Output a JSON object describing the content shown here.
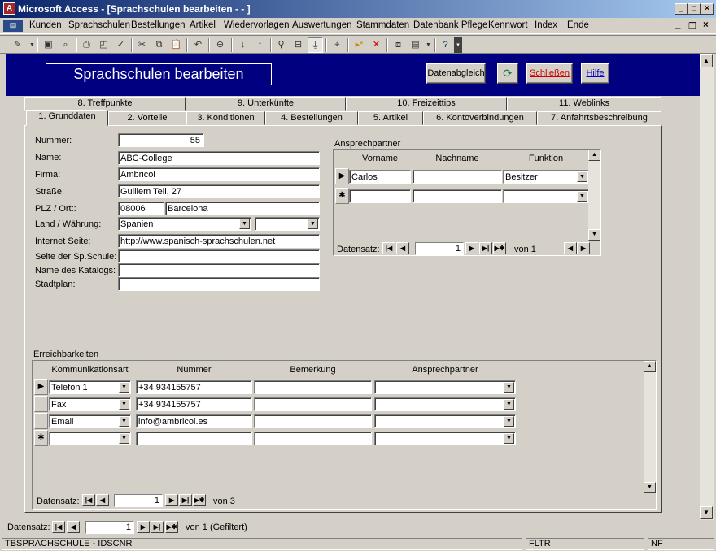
{
  "window": {
    "title": "Microsoft Access - [Sprachschulen bearbeiten - - ]"
  },
  "menu": [
    "Kunden",
    "Sprachschulen",
    "Bestellungen",
    "Artikel",
    "Wiedervorlagen",
    "Auswertungen",
    "Stammdaten",
    "Datenbank Pflege",
    "Kennwort",
    "Index",
    "Ende"
  ],
  "header": {
    "title": "Sprachschulen bearbeiten",
    "btn_sync": "Datenabgleich",
    "btn_close": "Schließen",
    "btn_help": "Hilfe"
  },
  "tabs_top": [
    "8. Treffpunkte",
    "9. Unterkünfte",
    "10. Freizeittips",
    "11. Weblinks"
  ],
  "tabs_bottom": [
    "1. Grunddaten",
    "2. Vorteile",
    "3. Konditionen",
    "4. Bestellungen",
    "5. Artikel",
    "6. Kontoverbindungen",
    "7. Anfahrtsbeschreibung"
  ],
  "form": {
    "labels": {
      "nummer": "Nummer:",
      "name": "Name:",
      "firma": "Firma:",
      "strasse": "Straße:",
      "plz": "PLZ / Ort::",
      "land": "Land / Währung:",
      "internet": "Internet Seite:",
      "seite": "Seite der Sp.Schule:",
      "katalog": "Name des Katalogs:",
      "stadtplan": "Stadtplan:"
    },
    "values": {
      "nummer": "55",
      "name": "ABC-College",
      "firma": "Ambricol",
      "strasse": "Guillem Tell, 27",
      "plz": "08006",
      "ort": "Barcelona",
      "land": "Spanien",
      "waehrung": "",
      "internet": "http://www.spanisch-sprachschulen.net",
      "seite": "",
      "katalog": "",
      "stadtplan": ""
    }
  },
  "contacts": {
    "title": "Ansprechpartner",
    "headers": [
      "Vorname",
      "Nachname",
      "Funktion"
    ],
    "rows": [
      {
        "vorname": "Carlos",
        "nachname": "",
        "funktion": "Besitzer"
      }
    ],
    "nav": {
      "label": "Datensatz:",
      "current": "1",
      "of": "von  1"
    }
  },
  "reach": {
    "title": "Erreichbarkeiten",
    "headers": [
      "Kommunikationsart",
      "Nummer",
      "Bemerkung",
      "Ansprechpartner"
    ],
    "rows": [
      {
        "art": "Telefon 1",
        "nummer": "+34 934155757",
        "bemerkung": "",
        "partner": ""
      },
      {
        "art": "Fax",
        "nummer": "+34 934155757",
        "bemerkung": "",
        "partner": ""
      },
      {
        "art": "Email",
        "nummer": "info@ambricol.es",
        "bemerkung": "",
        "partner": ""
      }
    ],
    "nav": {
      "label": "Datensatz:",
      "current": "1",
      "of": "von  3"
    }
  },
  "mainnav": {
    "label": "Datensatz:",
    "current": "1",
    "of": "von  1 (Gefiltert)"
  },
  "status": {
    "left": "TBSPRACHSCHULE - IDSCNR",
    "fltr": "FLTR",
    "nf": "NF"
  }
}
